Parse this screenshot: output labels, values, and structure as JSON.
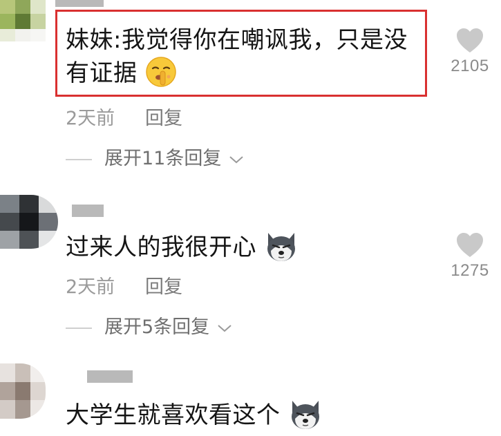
{
  "comments": [
    {
      "text": "妹妹:我觉得你在嘲讽我，只是没有证据",
      "line1": "妹妹:我觉得你在嘲讽我，只是没",
      "line2": "有证据",
      "emoji": "shushing-face-emoji",
      "time": "2天前",
      "reply_label": "回复",
      "expand_label": "展开11条回复",
      "likes": "2105",
      "highlighted": true
    },
    {
      "text": "过来人的我很开心",
      "emoji": "husky-dog-emoji",
      "time": "2天前",
      "reply_label": "回复",
      "expand_label": "展开5条回复",
      "likes": "1275",
      "highlighted": false
    },
    {
      "text": "大学生就喜欢看这个",
      "emoji": "husky-dog-emoji",
      "highlighted": false
    }
  ],
  "colors": {
    "highlight_border": "#d93030",
    "heart": "#c9c9c9",
    "meta_text": "#9a9a9a"
  }
}
